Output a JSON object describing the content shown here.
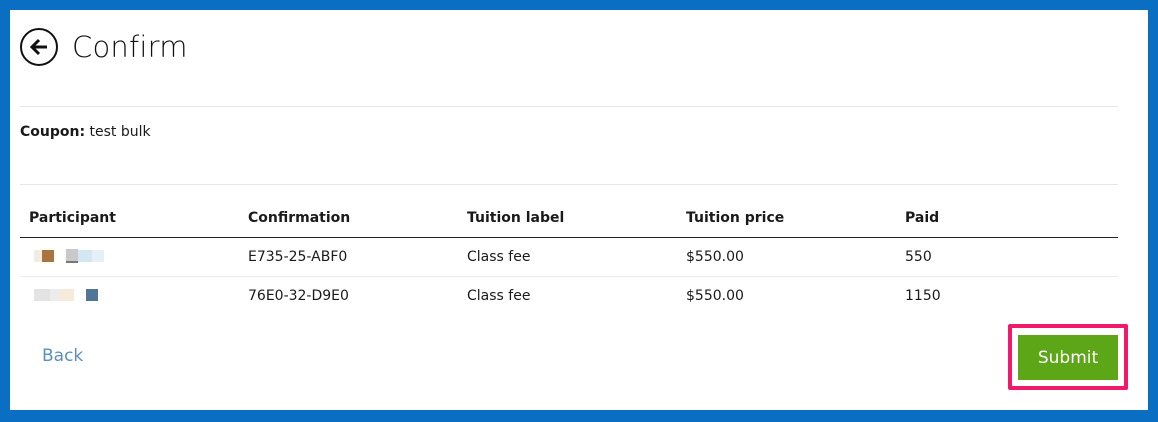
{
  "header": {
    "title": "Confirm",
    "back_icon": "arrow-left-circle-icon"
  },
  "coupon": {
    "label": "Coupon:",
    "value": "test bulk"
  },
  "table": {
    "headers": [
      "Participant",
      "Confirmation",
      "Tuition label",
      "Tuition price",
      "Paid"
    ],
    "rows": [
      {
        "participant": "",
        "confirmation": "E735-25-ABF0",
        "tuition_label": "Class fee",
        "tuition_price": "$550.00",
        "paid": "550"
      },
      {
        "participant": "",
        "confirmation": "76E0-32-D9E0",
        "tuition_label": "Class fee",
        "tuition_price": "$550.00",
        "paid": "1150"
      }
    ]
  },
  "actions": {
    "back_label": "Back",
    "submit_label": "Submit"
  },
  "colors": {
    "frame": "#0a6fc2",
    "submit": "#5ca617",
    "highlight": "#f0196b",
    "link": "#5b8fbd"
  }
}
